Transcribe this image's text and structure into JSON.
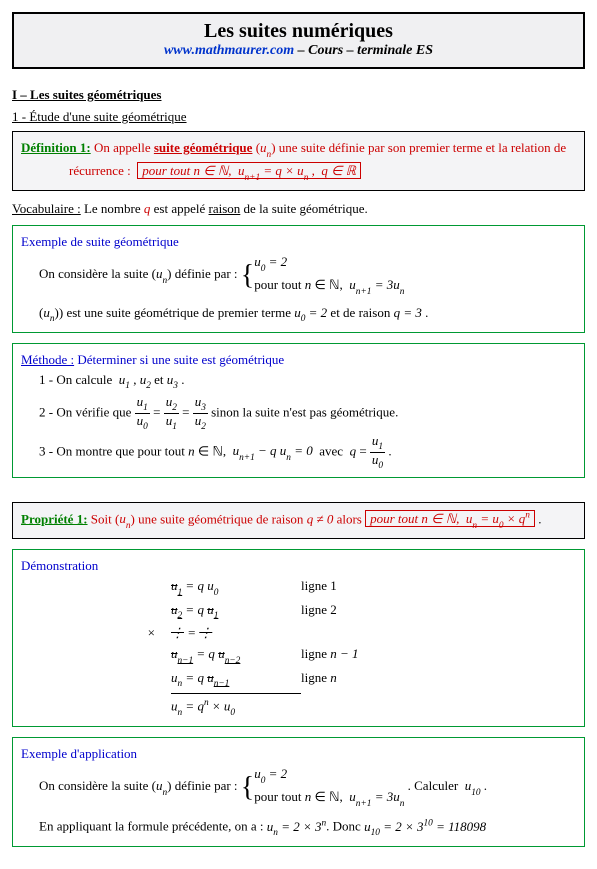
{
  "header": {
    "title": "Les suites numériques",
    "link": "www.mathmaurer.com",
    "subtitle_rest": " – Cours – terminale ES"
  },
  "section": {
    "roman": "I – Les suites géométriques",
    "sub1": "1 - Étude d'une suite géométrique"
  },
  "def1": {
    "label": "Définition 1:",
    "t1a": " On appelle ",
    "t1b": "suite géométrique",
    "t1c": " (",
    "seq": "u",
    "seq_sub": "n",
    "t1d": ") une suite définie par son premier terme et la relation de récurrence : ",
    "rec_line": "récurrence : ",
    "box": "pour tout n ∈ ℕ,  u_{n+1} = q × u_n ,  q ∈ ℝ"
  },
  "vocab": {
    "pre": "Vocabulaire :",
    "t1": " Le nombre ",
    "q": "q",
    "t2": " est appelé ",
    "raison": "raison",
    "t3": " de la suite géométrique."
  },
  "ex1": {
    "head": "Exemple de suite géométrique",
    "l1a": "On considère la suite (",
    "seq": "u",
    "seq_sub": "n",
    "l1b": ") définie par : ",
    "case1": "u₀ = 2",
    "case2": "pour tout n ∈ ℕ,  u_{n+1} = 3u_n",
    "l2a": "(",
    "l2b": ") est une suite géométrique de premier terme ",
    "l2c": "u₀ = 2",
    "l2d": "  et de raison ",
    "l2e": "q = 3",
    "l2f": " ."
  },
  "method": {
    "head": "Méthode :",
    "head2": " Déterminer si une suite est géométrique",
    "s1": "1 - On calcule  u₁ , u₂ et u₃ .",
    "s2a": "2 - On vérifie que ",
    "s2b": " sinon la suite n'est pas géométrique.",
    "s3a": "3 - On montre que pour tout n ∈ ℕ,  u_{n+1} − q u_n = 0  avec  q = ",
    "frac_u1": "u₁",
    "frac_u0": "u₀",
    "frac_u2": "u₂",
    "frac_u1b": "u₁",
    "frac_u3": "u₃",
    "frac_u2b": "u₂"
  },
  "prop1": {
    "label": "Propriété 1:",
    "t1": " Soit (",
    "seq": "u",
    "seq_sub": "n",
    "t2": ") une suite géométrique de raison ",
    "q_ne": "q ≠ 0",
    "t3": "  alors  ",
    "box": "pour tout n ∈ ℕ,  u_n = u₀ × qⁿ"
  },
  "demo": {
    "head": "Démonstration",
    "r1_l": "u₁ = q u₀",
    "r1_r": "ligne 1",
    "r2_l": "u₂ = q u₁",
    "r2_r": "ligne 2",
    "r3_l": "⋮ = ⋮",
    "r4_l": "u_{n-1} = q u_{n-2}",
    "r4_r": "ligne n − 1",
    "r5_l": "u_n = q u_{n-1}",
    "r5_r": "ligne n",
    "r6": "u_n = qⁿ × u₀",
    "mult": "×"
  },
  "ex2": {
    "head": "Exemple d'application",
    "l1a": "On considère la suite (",
    "seq": "u",
    "seq_sub": "n",
    "l1b": ") définie par : ",
    "case1": "u₀ = 2",
    "case2": "pour tout n ∈ ℕ,  u_{n+1} = 3u_n",
    "l1c": ". Calculer  u₁₀ .",
    "l2a": "En appliquant la formule précédente, on a :  ",
    "l2b": "u_n = 2 × 3ⁿ",
    "l2c": ". Donc ",
    "l2d": "u₁₀ = 2 × 3¹⁰ = 118098"
  }
}
